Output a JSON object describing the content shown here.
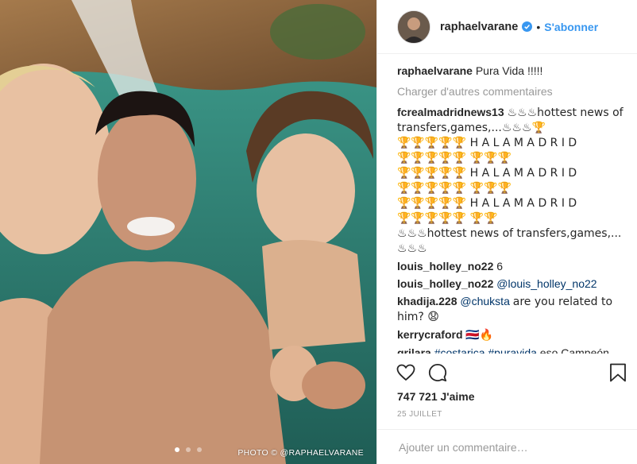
{
  "post": {
    "photo_credit": "PHOTO © @RAPHAELVARANE",
    "carousel_dots": 3,
    "active_dot": 0
  },
  "header": {
    "username": "raphaelvarane",
    "separator": "•",
    "follow_label": "S'abonner"
  },
  "caption": {
    "username": "raphaelvarane",
    "text": "Pura Vida !!!!!"
  },
  "load_more": "Charger d'autres commentaires",
  "comments": [
    {
      "username": "fcrealmadridnews13",
      "lines": [
        "♨♨♨hottest news of transfers,games,...♨♨♨🏆",
        "🏆🏆🏆🏆🏆 H A L A M A D R I D",
        "🏆🏆🏆🏆🏆 🏆🏆🏆",
        "🏆🏆🏆🏆🏆 H A L A M A D R I D",
        "🏆🏆🏆🏆🏆 🏆🏆🏆",
        "🏆🏆🏆🏆🏆 H A L A M A D R I D",
        "🏆🏆🏆🏆🏆 🏆🏆",
        "♨♨♨hottest news of transfers,games,...",
        "♨♨♨"
      ]
    },
    {
      "username": "louis_holley_no22",
      "text": "6"
    },
    {
      "username": "louis_holley_no22",
      "mention": "@louis_holley_no22",
      "text": ""
    },
    {
      "username": "khadija.228",
      "mention": "@chuksta",
      "text": "are you related to him? 😧"
    },
    {
      "username": "kerrycraford",
      "text": "🇨🇷🔥"
    },
    {
      "username": "grilara",
      "tags": "#costarica #puravida",
      "text": "eso Campeón"
    }
  ],
  "likes": "747 721 J'aime",
  "date": "25 JUILLET",
  "add_comment_placeholder": "Ajouter un commentaire…",
  "icons": {
    "like": "heart-icon",
    "comment": "comment-icon",
    "save": "bookmark-icon",
    "verified": "verified-badge-icon"
  },
  "colors": {
    "link_blue": "#3897f0",
    "muted": "#999999",
    "text": "#262626"
  }
}
